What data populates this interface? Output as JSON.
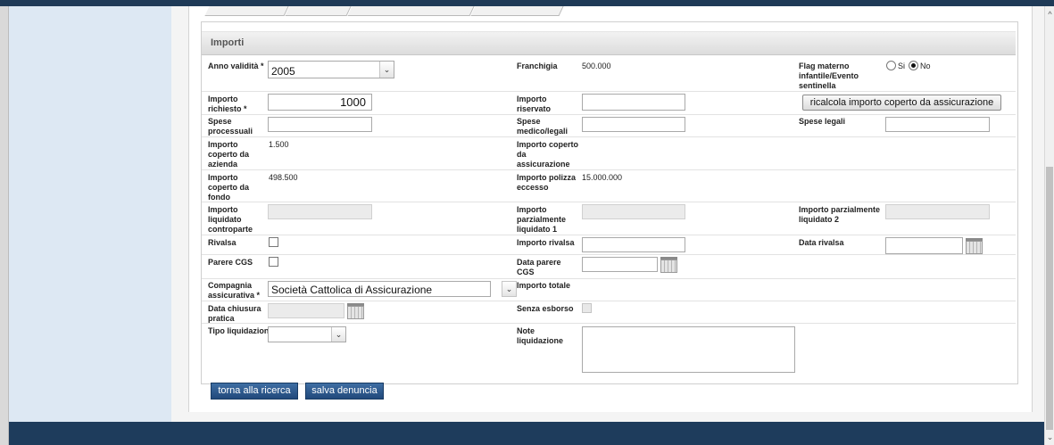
{
  "section_title": "Importi",
  "fields": {
    "anno_validita": {
      "label": "Anno validità *",
      "value": "2005"
    },
    "franchigia": {
      "label": "Franchigia",
      "value": "500.000"
    },
    "flag_materno": {
      "label": "Flag materno infantile/Evento sentinella",
      "option_si": "Si",
      "option_no": "No",
      "selected": "No"
    },
    "importo_richiesto": {
      "label": "Importo richiesto *",
      "value": "1000"
    },
    "importo_riservato": {
      "label": "Importo riservato",
      "value": ""
    },
    "ricalcola_button": "ricalcola importo coperto da assicurazione",
    "spese_processuali": {
      "label": "Spese processuali",
      "value": ""
    },
    "spese_medico_legali": {
      "label": "Spese medico/legali",
      "value": ""
    },
    "spese_legali": {
      "label": "Spese legali",
      "value": ""
    },
    "importo_coperto_azienda": {
      "label": "Importo coperto da azienda",
      "value": "1.500"
    },
    "importo_coperto_assicurazione": {
      "label": "Importo coperto da assicurazione",
      "value": ""
    },
    "importo_coperto_fondo": {
      "label": "Importo coperto da fondo",
      "value": "498.500"
    },
    "importo_polizza_eccesso": {
      "label": "Importo polizza eccesso",
      "value": "15.000.000"
    },
    "importo_liquidato_controparte": {
      "label": "Importo liquidato controparte",
      "value": ""
    },
    "importo_parzialmente_liquidato_1": {
      "label": "Importo parzialmente liquidato 1",
      "value": ""
    },
    "importo_parzialmente_liquidato_2": {
      "label": "Importo parzialmente liquidato 2",
      "value": ""
    },
    "rivalsa": {
      "label": "Rivalsa",
      "checked": false
    },
    "importo_rivalsa": {
      "label": "Importo rivalsa",
      "value": ""
    },
    "data_rivalsa": {
      "label": "Data rivalsa",
      "value": ""
    },
    "parere_cgs": {
      "label": "Parere CGS",
      "checked": false
    },
    "data_parere_cgs": {
      "label": "Data parere CGS",
      "value": ""
    },
    "compagnia_assicurativa": {
      "label": "Compagnia assicurativa *",
      "value": "Società Cattolica di Assicurazione"
    },
    "importo_totale": {
      "label": "Importo totale",
      "value": ""
    },
    "data_chiusura_pratica": {
      "label": "Data chiusura pratica",
      "value": ""
    },
    "senza_esborso": {
      "label": "Senza esborso",
      "checked": false
    },
    "tipo_liquidazione": {
      "label": "Tipo liquidazione",
      "value": ""
    },
    "note_liquidazione": {
      "label": "Note liquidazione",
      "value": ""
    }
  },
  "actions": {
    "torna": "torna alla ricerca",
    "salva": "salva denuncia"
  },
  "icons": {
    "calendar": "calendar-icon",
    "dropdown": "chevron-down-icon",
    "scroll_up": "scroll-up-arrow-icon",
    "scroll_down": "scroll-down-arrow-icon"
  },
  "colors": {
    "footer": "#1e3c5c",
    "sidebar": "#dde8f3",
    "button_blue": "#2c5890"
  }
}
